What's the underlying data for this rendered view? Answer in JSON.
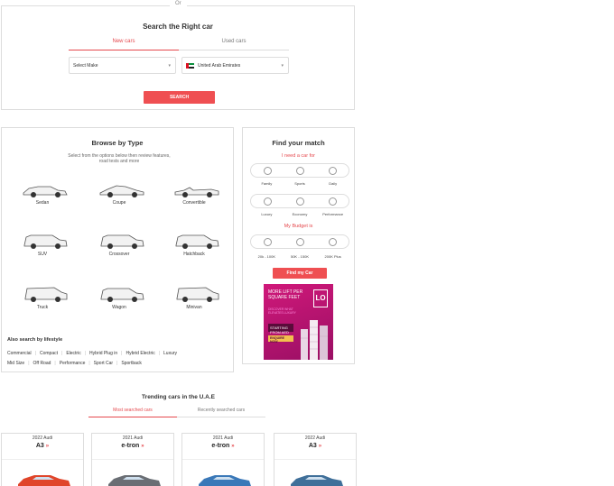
{
  "search": {
    "or_label": "Or",
    "title": "Search the Right car",
    "tabs": [
      {
        "label": "New cars"
      },
      {
        "label": "Used cars"
      }
    ],
    "make_placeholder": "Select Make",
    "country": "United Arab Emirates",
    "button": "SEARCH"
  },
  "browse": {
    "title": "Browse by Type",
    "subtitle": "Select from the options below then review features, road tests and more",
    "types": [
      {
        "label": "Sedan"
      },
      {
        "label": "Coupe"
      },
      {
        "label": "Convertible"
      },
      {
        "label": "SUV"
      },
      {
        "label": "Crossover"
      },
      {
        "label": "Hatchback"
      },
      {
        "label": "Truck"
      },
      {
        "label": "Wagon"
      },
      {
        "label": "Minivan"
      }
    ],
    "lifestyle_title": "Also search by lifestyle",
    "lifestyle_row1": [
      "Commercial",
      "Compact",
      "Electric",
      "Hybrid Plug in",
      "Hybrid Electric",
      "Luxury"
    ],
    "lifestyle_row2": [
      "Mid Size",
      "Off Road",
      "Performance",
      "Sport Car",
      "Sportback"
    ]
  },
  "match": {
    "title": "Find your match",
    "need_label": "I need a car for",
    "need_opts_1": [
      "Family",
      "Sports",
      "Daily"
    ],
    "need_opts_2": [
      "Luxury",
      "Economy",
      "Performance"
    ],
    "budget_label": "My Budget is",
    "budget_opts": [
      "20k - 100K",
      "50K - 150K",
      "200K Plus"
    ],
    "button": "Find my Car",
    "ad": {
      "headline": "MORE LIFT PER SQUARE FEET",
      "body": "DISCOVER WHAT ELEVATES LUXURY",
      "logo": "LO",
      "price": "STARTING FROM AED 1.44CR",
      "cta": "ENQUIRE NOW"
    }
  },
  "trending": {
    "title": "Trending cars in the U.A.E",
    "tabs": [
      {
        "label": "Most searched cars"
      },
      {
        "label": "Recently searched cars"
      }
    ],
    "cards": [
      {
        "year": "2022 Audi",
        "model": "A3",
        "color": "#e0452a"
      },
      {
        "year": "2021 Audi",
        "model": "e-tron",
        "color": "#6a6e74"
      },
      {
        "year": "2021 Audi",
        "model": "e-tron",
        "color": "#3a78b8"
      },
      {
        "year": "2022 Audi",
        "model": "A3",
        "color": "#3f6f99"
      }
    ]
  }
}
